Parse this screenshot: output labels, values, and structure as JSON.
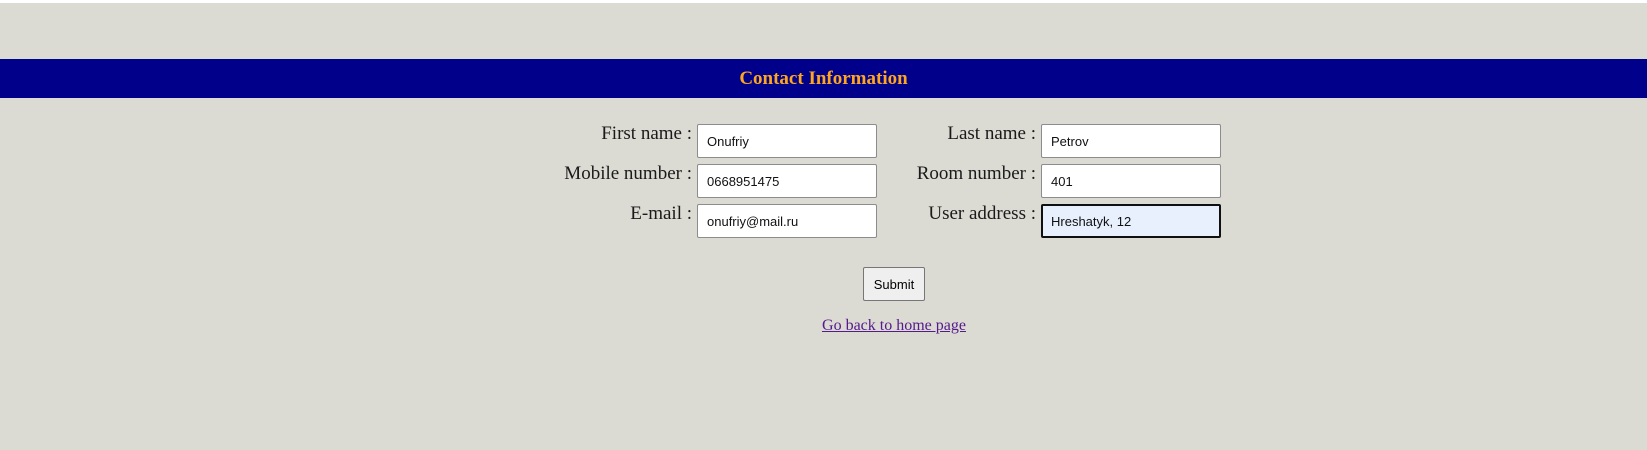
{
  "header": {
    "title": "Contact Information"
  },
  "form": {
    "first_name": {
      "label": "First name :",
      "value": "Onufriy"
    },
    "last_name": {
      "label": "Last name :",
      "value": "Petrov"
    },
    "mobile_number": {
      "label": "Mobile number :",
      "value": "0668951475"
    },
    "room_number": {
      "label": "Room number :",
      "value": "401"
    },
    "email": {
      "label": "E-mail :",
      "value": "onufriy@mail.ru"
    },
    "user_address": {
      "label": "User address :",
      "value": "Hreshatyk, 12"
    },
    "submit_label": "Submit"
  },
  "footer": {
    "home_link": "Go back to home page"
  },
  "colors": {
    "page_background": "#dbdad3",
    "banner_background": "#00008b",
    "banner_text": "#ffa620",
    "link_visited": "#551a8b",
    "focused_input_background": "#e8f0fe"
  }
}
